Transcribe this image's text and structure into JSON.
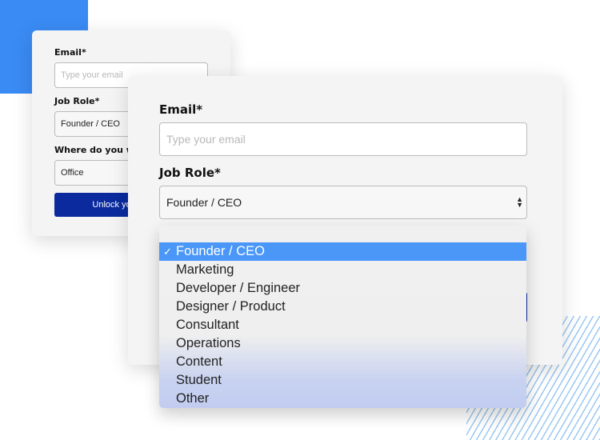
{
  "back_form": {
    "email_label": "Email*",
    "email_placeholder": "Type your email",
    "role_label": "Job Role*",
    "role_value": "Founder / CEO",
    "where_label": "Where do you work?",
    "where_value": "Office",
    "button_label": "Unlock your content"
  },
  "front_form": {
    "email_label": "Email*",
    "email_placeholder": "Type your email",
    "role_label": "Job Role*",
    "role_value": "Founder / CEO"
  },
  "dropdown": {
    "options": [
      "Founder / CEO",
      "Marketing",
      "Developer / Engineer",
      "Designer / Product",
      "Consultant",
      "Operations",
      "Content",
      "Student",
      "Other"
    ],
    "selected": "Founder / CEO"
  },
  "colors": {
    "accent": "#3a8bf4",
    "button": "#0a2a9e",
    "highlight": "#4a97f8"
  }
}
